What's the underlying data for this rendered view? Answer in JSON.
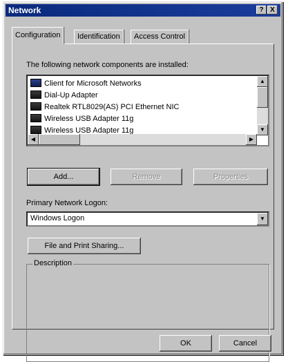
{
  "window": {
    "title": "Network"
  },
  "titlebar": {
    "help_label": "?",
    "close_label": "X"
  },
  "tabs": [
    {
      "label": "Configuration",
      "active": true
    },
    {
      "label": "Identification",
      "active": false
    },
    {
      "label": "Access Control",
      "active": false
    }
  ],
  "configuration": {
    "installed_label": "The following network components are installed:",
    "components": [
      {
        "label": "Client for Microsoft Networks",
        "icon": "network-client-icon"
      },
      {
        "label": "Dial-Up Adapter",
        "icon": "network-adapter-icon"
      },
      {
        "label": "Realtek RTL8029(AS) PCI Ethernet NIC",
        "icon": "network-adapter-icon"
      },
      {
        "label": "Wireless USB Adapter 11g",
        "icon": "network-adapter-icon"
      },
      {
        "label": "Wireless USB Adapter 11g",
        "icon": "network-adapter-icon"
      }
    ],
    "buttons": {
      "add": "Add...",
      "remove": "Remove",
      "properties": "Properties"
    },
    "logon_label": "Primary Network Logon:",
    "logon_value": "Windows Logon",
    "file_print_label": "File and Print Sharing...",
    "description_label": "Description"
  },
  "footer": {
    "ok": "OK",
    "cancel": "Cancel"
  }
}
